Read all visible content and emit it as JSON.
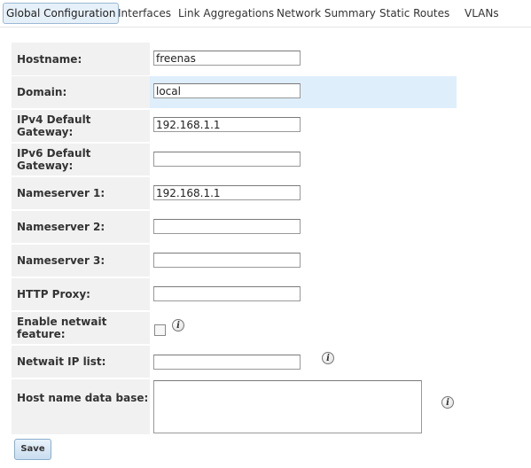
{
  "tabs": [
    {
      "label": "Global Configuration",
      "active": true
    },
    {
      "label": "Interfaces"
    },
    {
      "label": "Link Aggregations"
    },
    {
      "label": "Network Summary"
    },
    {
      "label": "Static Routes"
    },
    {
      "label": "VLANs"
    }
  ],
  "form": {
    "hostname": {
      "label": "Hostname:",
      "value": "freenas"
    },
    "domain": {
      "label": "Domain:",
      "value": "local"
    },
    "ipv4_gateway": {
      "label": "IPv4 Default Gateway:",
      "value": "192.168.1.1"
    },
    "ipv6_gateway": {
      "label": "IPv6 Default Gateway:",
      "value": ""
    },
    "nameserver1": {
      "label": "Nameserver 1:",
      "value": "192.168.1.1"
    },
    "nameserver2": {
      "label": "Nameserver 2:",
      "value": ""
    },
    "nameserver3": {
      "label": "Nameserver 3:",
      "value": ""
    },
    "http_proxy": {
      "label": "HTTP Proxy:",
      "value": ""
    },
    "netwait_enable": {
      "label": "Enable netwait feature:",
      "checked": false,
      "icon": "info-icon"
    },
    "netwait_ips": {
      "label": "Netwait IP list:",
      "value": "",
      "icon": "info-icon"
    },
    "hosts_db": {
      "label": "Host name data base:",
      "value": "",
      "icon": "info-icon"
    }
  },
  "info_glyph": "i",
  "save_label": "Save",
  "colors": {
    "highlight_row": "#dfeefb",
    "label_bg": "#f1f1f1",
    "active_tab_bg": "#e6f0f8"
  }
}
